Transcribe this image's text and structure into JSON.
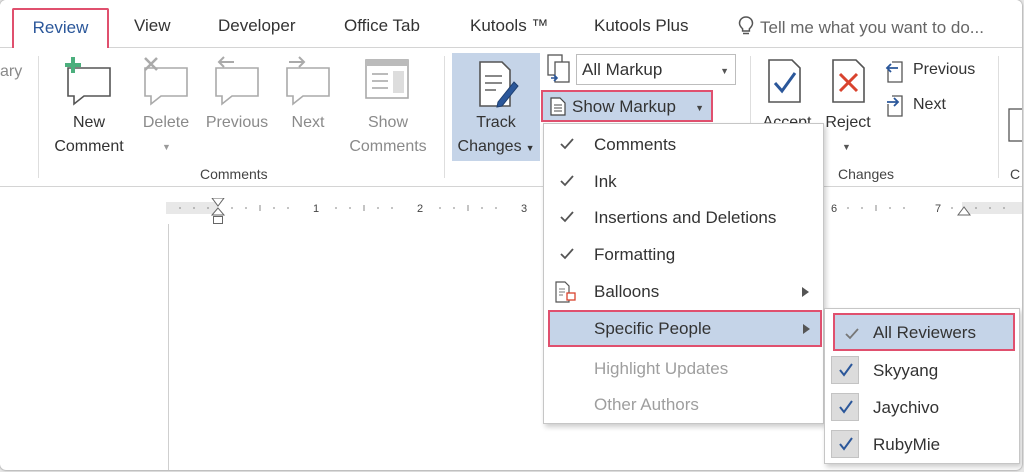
{
  "tabs": {
    "active": "Review",
    "items": [
      "View",
      "Developer",
      "Office Tab",
      "Kutools ™",
      "Kutools Plus"
    ],
    "tell_me": "Tell me what you want to do..."
  },
  "ribbon": {
    "partial_left_label": "ary",
    "comments_group": {
      "name": "Comments",
      "new_comment": [
        "New",
        "Comment"
      ],
      "delete": "Delete",
      "previous": "Previous",
      "next": "Next",
      "show_comments": [
        "Show",
        "Comments"
      ]
    },
    "tracking_group": {
      "track_changes": [
        "Track",
        "Changes"
      ],
      "markup_select": "All Markup",
      "show_markup": "Show Markup"
    },
    "changes_group": {
      "name": "Changes",
      "accept": "Accept",
      "reject": "Reject",
      "previous": "Previous",
      "next": "Next",
      "partial_right_label": "C"
    }
  },
  "ruler": {
    "numbers": [
      "1",
      "2",
      "3",
      "6",
      "7"
    ]
  },
  "show_markup_menu": {
    "items": [
      {
        "label": "Comments",
        "checked": true
      },
      {
        "label": "Ink",
        "checked": true
      },
      {
        "label": "Insertions and Deletions",
        "checked": true
      },
      {
        "label": "Formatting",
        "checked": true
      },
      {
        "label": "Balloons",
        "submenu": true
      },
      {
        "label": "Specific People",
        "submenu": true,
        "highlighted": true
      },
      {
        "label": "Highlight Updates",
        "disabled": true
      },
      {
        "label": "Other Authors",
        "disabled": true
      }
    ]
  },
  "specific_people_menu": {
    "items": [
      {
        "label": "All Reviewers",
        "checked": true,
        "highlighted": true
      },
      {
        "label": "Skyyang",
        "checked": true
      },
      {
        "label": "Jaychivo",
        "checked": true
      },
      {
        "label": "RubyMie",
        "checked": true
      }
    ]
  },
  "colors": {
    "accent": "#2b579a",
    "highlight": "#c5d4e8",
    "annotation_border": "#e0506e",
    "checkmark": "#2b579a"
  }
}
